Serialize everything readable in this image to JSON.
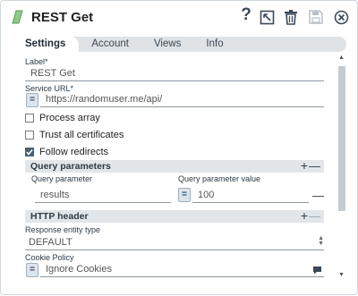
{
  "header": {
    "title": "REST Get",
    "logo_color": "#8fc98a"
  },
  "tabs": [
    {
      "label": "Settings",
      "active": true
    },
    {
      "label": "Account",
      "active": false
    },
    {
      "label": "Views",
      "active": false
    },
    {
      "label": "Info",
      "active": false
    }
  ],
  "form": {
    "label_field": {
      "label": "Label*",
      "value": "REST Get"
    },
    "service_url": {
      "label": "Service URL*",
      "value": "https://randomuser.me/api/",
      "expr_button": "="
    },
    "process_array": {
      "label": "Process array",
      "checked": false
    },
    "trust_all_certs": {
      "label": "Trust all certificates",
      "checked": false
    },
    "follow_redirects": {
      "label": "Follow redirects",
      "checked": true
    },
    "query_parameters": {
      "title": "Query parameters",
      "add": "+",
      "remove": "—",
      "col_param": "Query parameter",
      "col_value": "Query parameter value",
      "rows": [
        {
          "param": "results",
          "expr_button": "=",
          "value": "100",
          "remove": "—"
        }
      ]
    },
    "http_header": {
      "title": "HTTP header",
      "add": "+",
      "remove": "—"
    },
    "response_entity_type": {
      "label": "Response entity type",
      "value": "DEFAULT"
    },
    "cookie_policy": {
      "label": "Cookie Policy",
      "value": "Ignore Cookies",
      "expr_button": "="
    }
  },
  "colors": {
    "accent": "#4b5f73",
    "tab_bar": "#dfe3e6",
    "section_bg": "#e3e6e9"
  }
}
